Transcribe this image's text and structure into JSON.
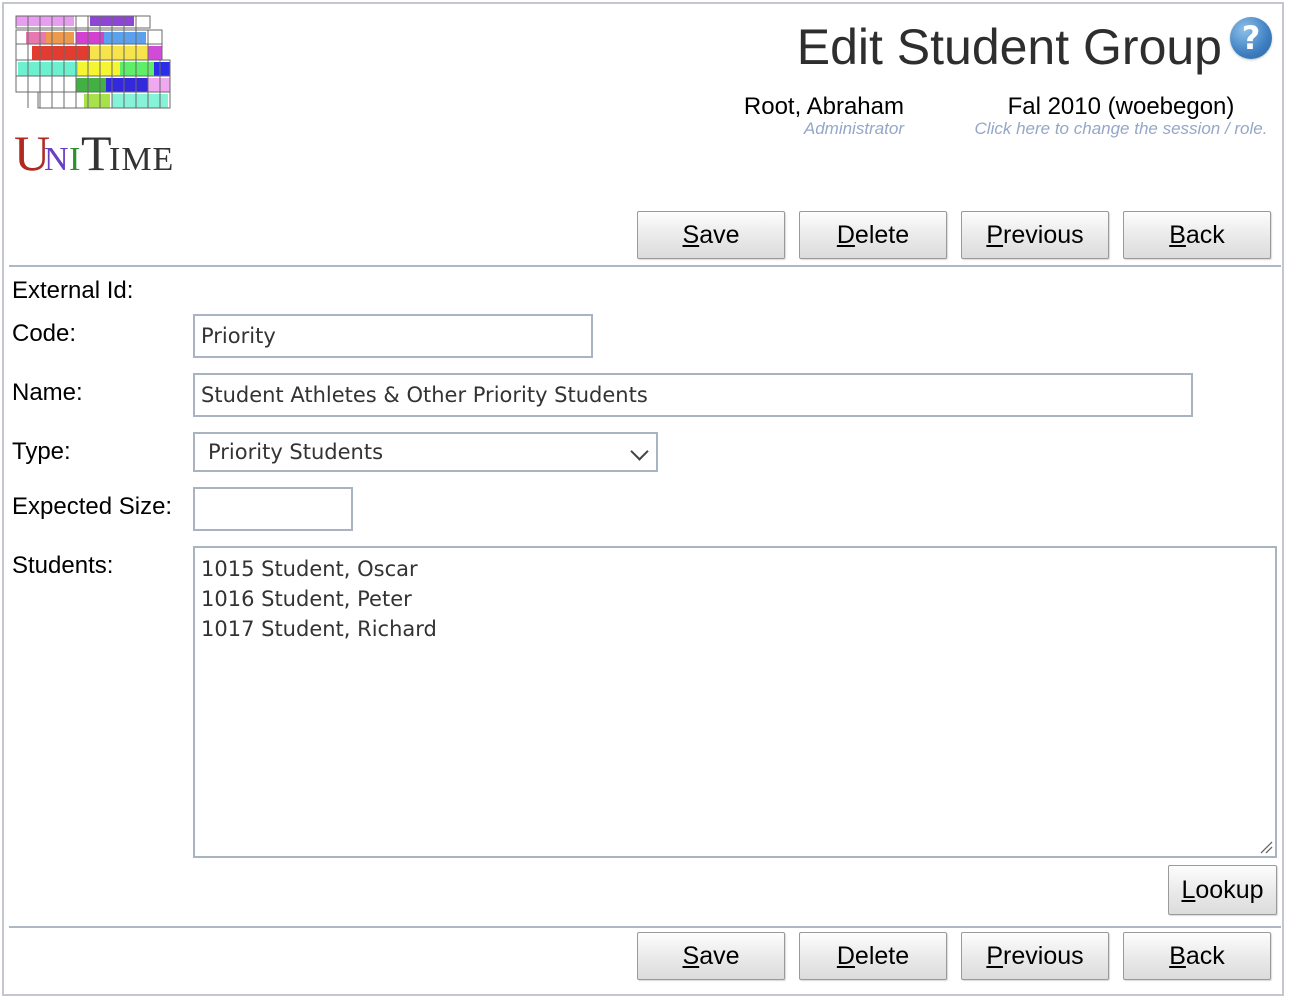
{
  "app": {
    "logo_text": "UniTime"
  },
  "header": {
    "title": "Edit Student Group",
    "user_name": "Root, Abraham",
    "user_role": "Administrator",
    "session_name": "Fal 2010 (woebegon)",
    "session_hint": "Click here to change the session / role."
  },
  "toolbar": {
    "save_acc": "S",
    "save_rest": "ave",
    "delete_acc": "D",
    "delete_rest": "elete",
    "previous_acc": "P",
    "previous_rest": "revious",
    "back_acc": "B",
    "back_rest": "ack"
  },
  "form": {
    "external_id_label": "External Id:",
    "code_label": "Code:",
    "code_value": "Priority",
    "name_label": "Name:",
    "name_value": "Student Athletes & Other Priority Students",
    "type_label": "Type:",
    "type_value": "Priority Students",
    "expected_size_label": "Expected Size:",
    "expected_size_value": "",
    "students_label": "Students:",
    "students": [
      "1015 Student, Oscar",
      "1016 Student, Peter",
      "1017 Student, Richard"
    ],
    "lookup_acc": "L",
    "lookup_rest": "ookup"
  },
  "colors": {
    "accent_help": "#3d7fc1",
    "hint_text": "#94a7c7",
    "border": "#a9b4c2"
  }
}
